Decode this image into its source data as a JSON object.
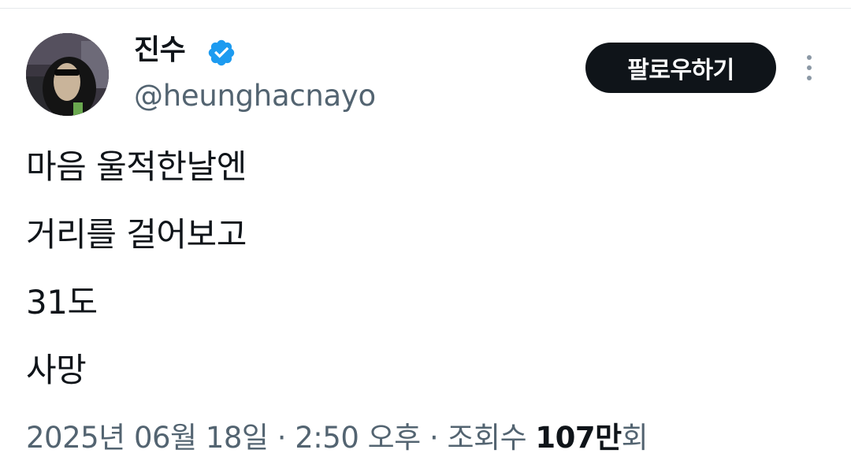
{
  "profile": {
    "display_name": "진수",
    "handle": "@heunghacnayo",
    "verified_color": "#1d9bf0"
  },
  "actions": {
    "follow_label": "팔로우하기"
  },
  "tweet": {
    "lines": [
      "마음 울적한날엔",
      "거리를 걸어보고",
      "31도",
      "사망"
    ]
  },
  "meta": {
    "date": "2025년 06월 18일",
    "separator": "·",
    "time": "2:50 오후",
    "views_label_prefix": "조회수",
    "views_count": "107만",
    "views_label_suffix": "회"
  },
  "icons": {
    "verified": "verified-badge-icon",
    "more": "more-options-icon"
  }
}
